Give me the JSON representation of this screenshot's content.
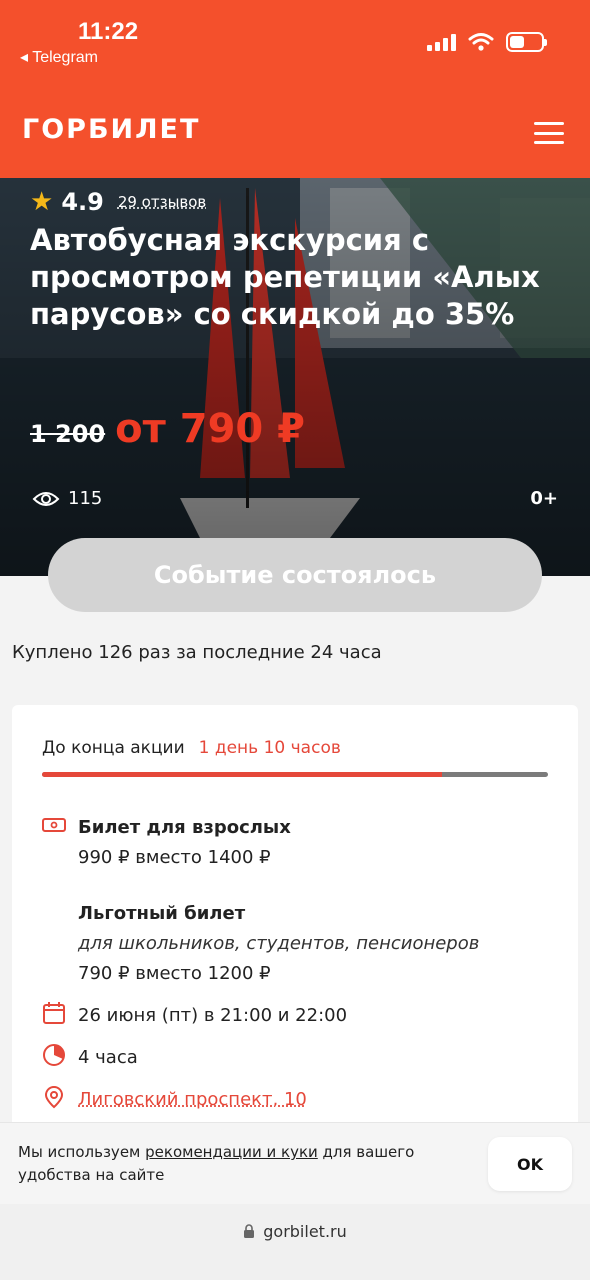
{
  "status": {
    "time": "11:22",
    "back_app": "◂ Telegram"
  },
  "header": {
    "logo": "ГОРБИЛЕТ"
  },
  "hero": {
    "rating": "4.9",
    "reviews": "29 отзывов",
    "title": "Автобусная экскурсия с просмотром репетиции «Алых парусов» со скидкой до 35%",
    "old_price": "1 200",
    "price": "от 790 ₽",
    "views": "115",
    "age": "0+"
  },
  "event_button": "Событие состоялось",
  "bought_text": "Куплено 126 раз за последние 24 часа",
  "promo": {
    "label": "До конца акции",
    "time_left": "1 день 10 часов",
    "progress": 0.79
  },
  "tickets": {
    "adult_title": "Билет для взрослых",
    "adult_price": "990 ₽ вместо 1400 ₽",
    "reduced_title": "Льготный билет",
    "reduced_note": "для школьников, студентов, пенсионеров",
    "reduced_price": "790 ₽ вместо 1200 ₽"
  },
  "details": {
    "date": "26 июня (пт) в 21:00 и 22:00",
    "duration": "4 часа",
    "address": "Лиговский проспект, 10"
  },
  "cookie": {
    "text_before": "Мы используем ",
    "link": "рекомендации и куки",
    "text_after": " для вашего удобства на сайте",
    "ok": "OK"
  },
  "browser": {
    "url": "gorbilet.ru"
  },
  "colors": {
    "brand": "#f4502c",
    "accent_red": "#e5483a",
    "star": "#f5b819"
  }
}
